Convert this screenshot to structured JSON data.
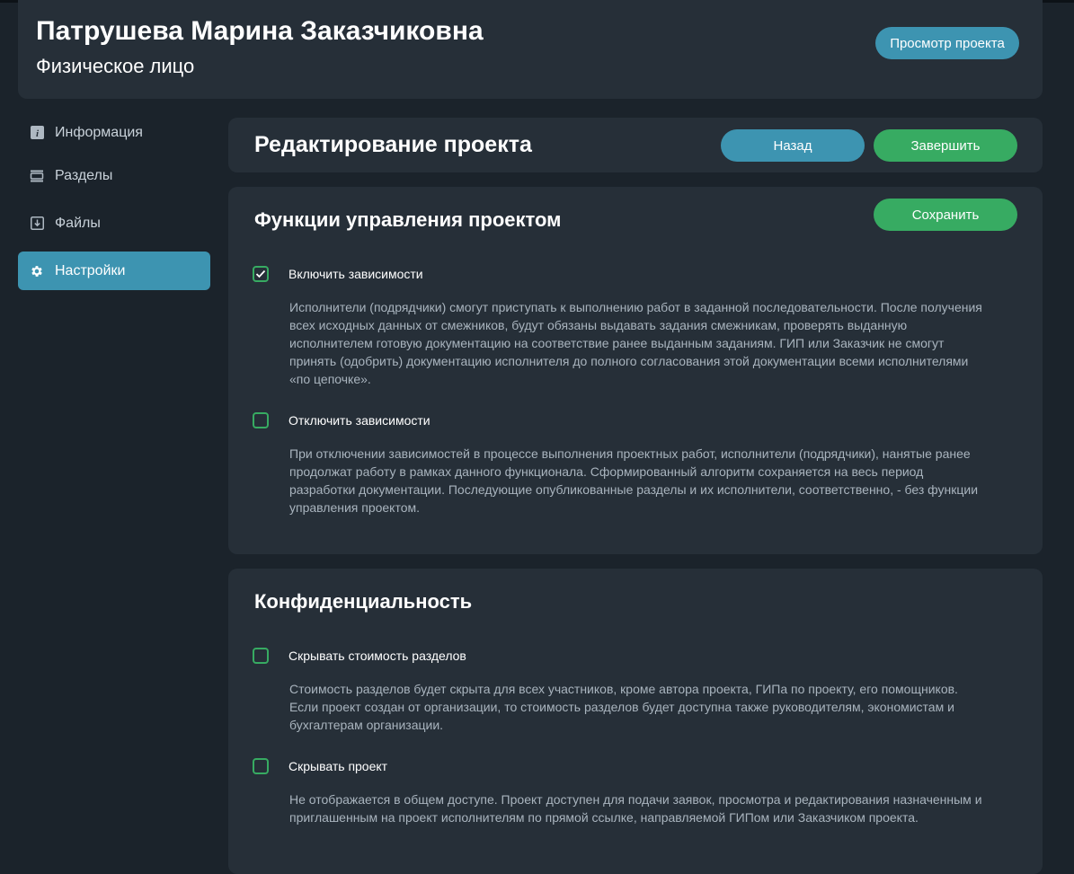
{
  "header": {
    "name": "Патрушева Марина Заказчиковна",
    "subtitle": "Физическое лицо",
    "view_project_label": "Просмотр проекта"
  },
  "sidebar": {
    "items": [
      {
        "label": "Информация",
        "icon": "info-icon"
      },
      {
        "label": "Разделы",
        "icon": "sections-icon"
      },
      {
        "label": "Файлы",
        "icon": "download-file-icon"
      },
      {
        "label": "Настройки",
        "icon": "gear-icon",
        "active": true
      }
    ]
  },
  "edit": {
    "title": "Редактирование проекта",
    "back_label": "Назад",
    "finish_label": "Завершить"
  },
  "functions": {
    "title": "Функции управления проектом",
    "save_label": "Сохранить",
    "options": [
      {
        "label": "Включить зависимости",
        "checked": true,
        "description": "Исполнители (подрядчики) смогут приступать к выполнению работ в заданной последовательности. После получения всех исходных данных от смежников, будут обязаны выдавать задания смежникам, проверять выданную исполнителем готовую документацию на соответствие ранее выданным заданиям. ГИП или Заказчик не смогут принять (одобрить) документацию исполнителя до полного согласования этой документации всеми исполнителями «по цепочке»."
      },
      {
        "label": "Отключить зависимости",
        "checked": false,
        "description": "При отключении зависимостей в процессе выполнения проектных работ, исполнители (подрядчики), нанятые ранее продолжат работу в рамках данного функционала. Сформированный алгоритм сохраняется на весь период разработки документации. Последующие опубликованные разделы и их исполнители, соответственно, - без функции управления проектом."
      }
    ]
  },
  "confidentiality": {
    "title": "Конфиденциальность",
    "options": [
      {
        "label": "Скрывать стоимость разделов",
        "checked": false,
        "description": "Стоимость разделов будет скрыта для всех участников, кроме автора проекта, ГИПа по проекту, его помощников. Если проект создан от организации, то стоимость разделов будет доступна также руководителям, экономистам и бухгалтерам организации."
      },
      {
        "label": "Скрывать проект",
        "checked": false,
        "description": "Не отображается в общем доступе. Проект доступен для подачи заявок, просмотра и редактирования назначенным и приглашенным на проект исполнителям по прямой ссылке, направляемой ГИПом или Заказчиком проекта."
      }
    ]
  },
  "colors": {
    "background": "#1b232b",
    "card": "#262f38",
    "accent_blue": "#3d94b1",
    "accent_green": "#37ab62",
    "muted_text": "#a9b4be"
  }
}
